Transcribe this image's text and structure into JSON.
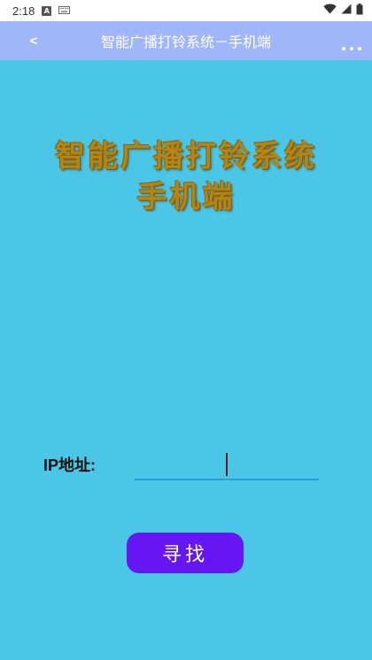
{
  "status_bar": {
    "time": "2:18",
    "notification_icon_letter": "A",
    "icons": [
      "a-notification-icon",
      "keyboard-icon",
      "wifi-icon",
      "signal-icon",
      "battery-icon"
    ]
  },
  "app_bar": {
    "back_label": "<",
    "title": "智能广播打铃系统－手机端",
    "more_icon": "more-dots-icon",
    "background": "#9fb6f9"
  },
  "main": {
    "heading_line1": "智能广播打铃系统",
    "heading_line2": "手机端",
    "heading_color": "#b68412",
    "background": "#4cc6e6",
    "ip_label": "IP地址:",
    "ip_value": "",
    "find_button_label": "寻找",
    "button_color": "#6516f2"
  }
}
